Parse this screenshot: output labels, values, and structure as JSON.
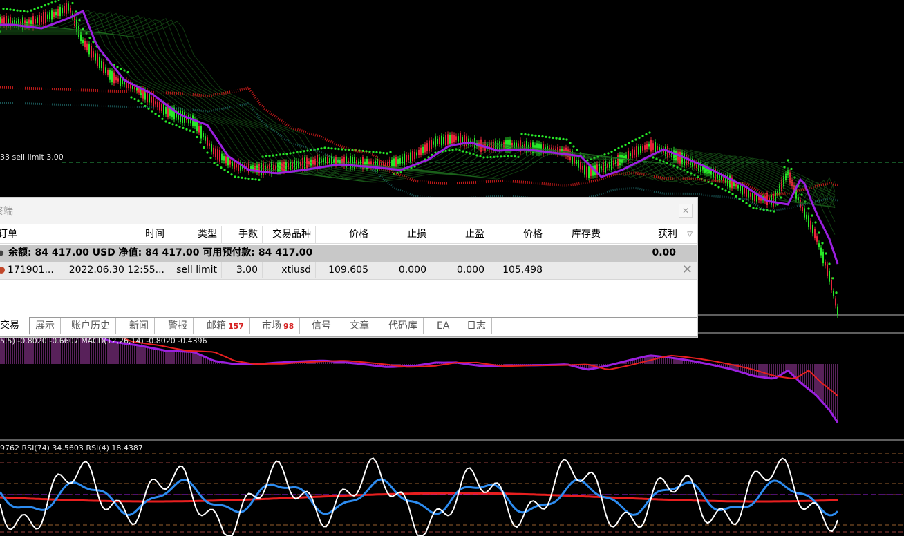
{
  "chart": {
    "order_line_label": "33 sell limit 3.00",
    "macd_label": "5,5) -0.8020 -0.6607  MACD(12,26,14) -0.8020 -0.4396",
    "rsi_label": "9762  RSI(74) 34.5603  RSI(4) 18.4387",
    "colors": {
      "background": "#000000",
      "price_up": "#27e827",
      "price_down": "#e8233a",
      "ma_fast": "#9b1fe0",
      "ma_slow": "#e81f1f",
      "ribbon": "#1f6e1f",
      "macd_hist": "#c24ac9",
      "rsi_fast": "#ffffff",
      "rsi_mid": "#2d8cf0",
      "rsi_slow": "#e81f1f"
    }
  },
  "terminal": {
    "title": "终端",
    "columns": [
      {
        "label": "订单",
        "align": "left"
      },
      {
        "label": "时间",
        "align": "right"
      },
      {
        "label": "类型",
        "align": "right"
      },
      {
        "label": "手数",
        "align": "right"
      },
      {
        "label": "交易品种",
        "align": "right"
      },
      {
        "label": "价格",
        "align": "right"
      },
      {
        "label": "止损",
        "align": "right"
      },
      {
        "label": "止盈",
        "align": "right"
      },
      {
        "label": "价格",
        "align": "right"
      },
      {
        "label": "库存费",
        "align": "right"
      },
      {
        "label": "获利",
        "align": "right"
      }
    ],
    "balance_row": {
      "text": "余额: 84 417.00 USD  净值: 84 417.00  可用预付款: 84 417.00",
      "profit": "0.00"
    },
    "order": {
      "ticket": "171901...",
      "time": "2022.06.30 12:55...",
      "type": "sell limit",
      "lots": "3.00",
      "symbol": "xtiusd",
      "open_price": "109.605",
      "sl": "0.000",
      "tp": "0.000",
      "price": "105.498",
      "swap": "",
      "profit": ""
    },
    "tabs": [
      {
        "label": "交易",
        "badge": ""
      },
      {
        "label": "展示",
        "badge": ""
      },
      {
        "label": "账户历史",
        "badge": ""
      },
      {
        "label": "新闻",
        "badge": ""
      },
      {
        "label": "警报",
        "badge": ""
      },
      {
        "label": "邮箱",
        "badge": "157"
      },
      {
        "label": "市场",
        "badge": "98"
      },
      {
        "label": "信号",
        "badge": ""
      },
      {
        "label": "文章",
        "badge": ""
      },
      {
        "label": "代码库",
        "badge": ""
      },
      {
        "label": "EA",
        "badge": ""
      },
      {
        "label": "日志",
        "badge": ""
      }
    ]
  }
}
